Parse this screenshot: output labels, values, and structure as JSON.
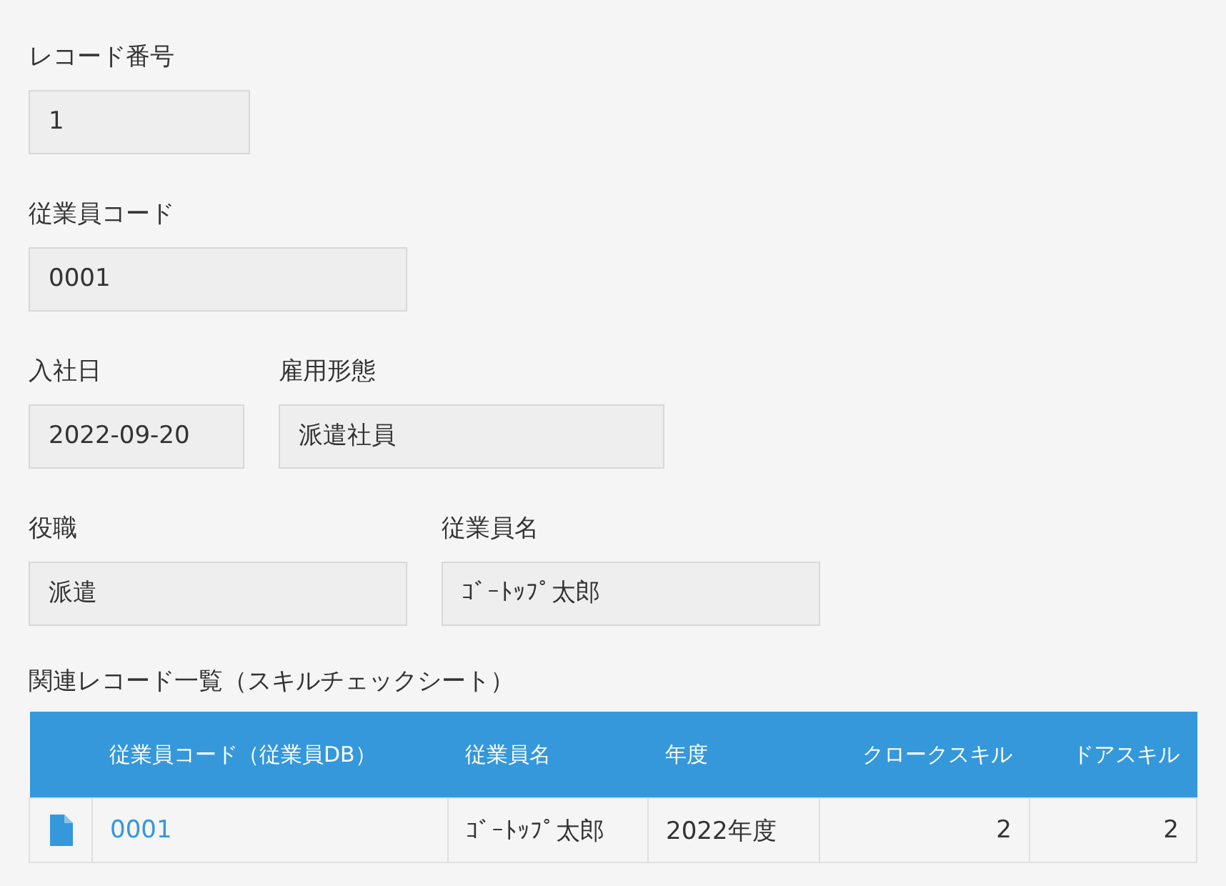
{
  "field_rows": [
    [
      {
        "label": "レコード番号",
        "value": "1"
      }
    ],
    [
      {
        "label": "従業員コード",
        "value": "0001"
      }
    ],
    [
      {
        "label": "入社日",
        "value": "2022-09-20"
      },
      {
        "label": "雇用形態",
        "value": "派遣社員"
      }
    ],
    [
      {
        "label": "役職",
        "value": "派遣"
      },
      {
        "label": "従業員名",
        "value": "ｺﾞｰﾄｯﾌﾟ太郎"
      }
    ]
  ],
  "related_records": {
    "title": "関連レコード一覧（スキルチェックシート）",
    "columns": [
      {
        "label": "従業員コード（従業員DB）",
        "kind": "link"
      },
      {
        "label": "従業員名",
        "kind": "text"
      },
      {
        "label": "年度",
        "kind": "text"
      },
      {
        "label": "クロークスキル",
        "kind": "number"
      },
      {
        "label": "ドアスキル",
        "kind": "number"
      }
    ],
    "rows": [
      {
        "cells": [
          "0001",
          "ｺﾞｰﾄｯﾌﾟ太郎",
          "2022年度",
          "2",
          "2"
        ]
      }
    ]
  }
}
